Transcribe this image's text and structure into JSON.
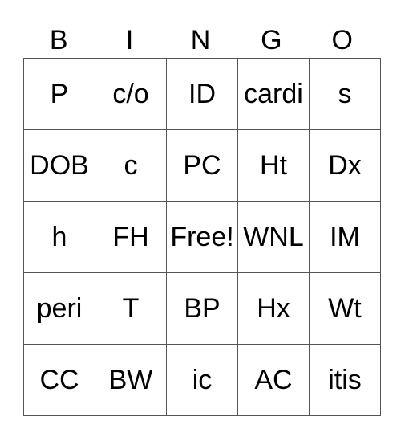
{
  "header": [
    "B",
    "I",
    "N",
    "G",
    "O"
  ],
  "grid": [
    [
      "P",
      "c/o",
      "ID",
      "cardi",
      "s"
    ],
    [
      "DOB",
      "c",
      "PC",
      "Ht",
      "Dx"
    ],
    [
      "h",
      "FH",
      "Free!",
      "WNL",
      "IM"
    ],
    [
      "peri",
      "T",
      "BP",
      "Hx",
      "Wt"
    ],
    [
      "CC",
      "BW",
      "ic",
      "AC",
      "itis"
    ]
  ]
}
